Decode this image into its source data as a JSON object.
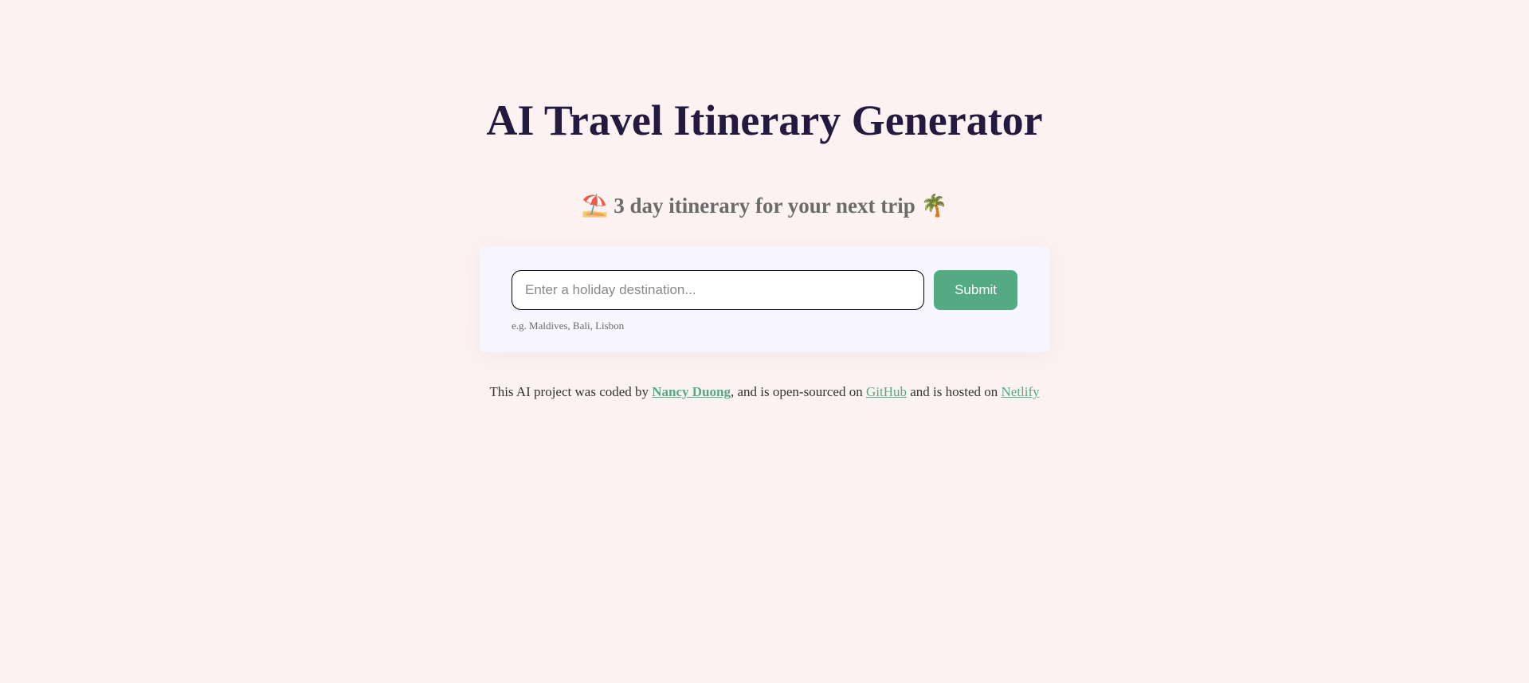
{
  "header": {
    "title": "AI Travel Itinerary Generator",
    "subtitle": "⛱️ 3 day itinerary for your next trip 🌴"
  },
  "form": {
    "destination_placeholder": "Enter a holiday destination...",
    "destination_value": "",
    "example_hint": "e.g. Maldives, Bali, Lisbon",
    "submit_label": "Submit"
  },
  "footer": {
    "text_part1": "This AI project was coded by ",
    "author_name": "Nancy Duong",
    "text_part2": ", and is open-sourced on ",
    "github_label": "GitHub",
    "text_part3": " and is hosted on ",
    "netlify_label": "Netlify"
  }
}
